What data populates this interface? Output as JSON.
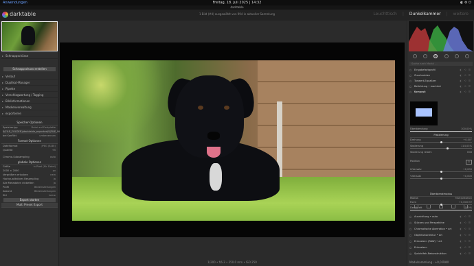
{
  "os": {
    "app_menu": "Anwendungen",
    "clock": "Freitag, 18. Juli 2025 | 14:32",
    "tray": "◐ ⚙ ⏻"
  },
  "window": {
    "title": "darktable"
  },
  "header": {
    "app_name": "darktable",
    "collection_info": "1 Bild (#4) ausgewählt von 994 in aktueller Sammlung",
    "views": [
      "Leuchttisch",
      "Dunkelkammer",
      "weitere"
    ],
    "active_view": "Dunkelkammer"
  },
  "left": {
    "snapshots_label": "Schnappschüsse",
    "create_snapshot": "Schnappschuss erstellen",
    "modules": [
      "Verlauf",
      "Duplikat-Manager",
      "Pipette",
      "Verschlagwortung / Tagging",
      "Bildinformationen",
      "Maskenverwaltung",
      "exportieren"
    ],
    "storage_title": "Speicher-Optionen",
    "storage_rows": [
      {
        "k": "Speichertyp",
        "v": "Datei auf Festplatte"
      },
      {
        "k": "$(FILE_FOLDER)/darktable_exported/$(FILE_NAME)",
        "v": "…"
      },
      {
        "k": "bei Konflikt",
        "v": "umbenennen"
      }
    ],
    "format_title": "Format-Optionen",
    "format_rows": [
      {
        "k": "Dateiformat",
        "v": "JPEG (8-Bit)"
      },
      {
        "k": "Qualität",
        "v": "95"
      },
      {
        "k": "Chroma-Subsampling",
        "v": "auto"
      }
    ],
    "global_title": "globale Optionen",
    "global_rows": [
      {
        "k": "Größe",
        "v": "in Pixel (für Datei)"
      },
      {
        "k": "2000 × 2000",
        "v": "px"
      },
      {
        "k": "Vergrößern erlauben",
        "v": "nein"
      },
      {
        "k": "Hochqualitatives Resampling",
        "v": "ja"
      },
      {
        "k": "Alle Metadaten einbetten",
        "v": "ja"
      },
      {
        "k": "Profil",
        "v": "Bildeinstellungen"
      },
      {
        "k": "Absicht",
        "v": "Bildeinstellungen"
      },
      {
        "k": "Stil",
        "v": "keine"
      }
    ],
    "export_button": "Export starten",
    "multi_export_button": "Multi Preset Export"
  },
  "center": {
    "statusline": "1/200 • f/6.3 • 250.0 mm • ISO 250"
  },
  "right": {
    "search_placeholder": "Suche nach Modul …",
    "modules_top": [
      "Eingabefarbprofil",
      "Zuschneiden",
      "Tonwert-Equalizer",
      "Belichtung • markiert",
      "Komposit"
    ],
    "preview_label": "Überblendung",
    "preview_value": "100,00%",
    "placement_title": "Platzierung",
    "placement_sliders": [
      {
        "label": "Drehung",
        "value": "+0,00°",
        "pct": 50
      },
      {
        "label": "Skalierung",
        "value": "114,03%",
        "pct": 60
      },
      {
        "label": "Skalierung relativ",
        "value": "Bild",
        "pct": 0
      },
      {
        "label": "Position",
        "value": "⊡",
        "pct": 0
      },
      {
        "label": "X-Versatz",
        "value": "+0,000",
        "pct": 50
      },
      {
        "label": "Y-Versatz",
        "value": "+0,000",
        "pct": 50
      }
    ],
    "blend_title": "Überblendmodus",
    "blend_rows": [
      {
        "label": "Modus",
        "value": "Multiplikation"
      },
      {
        "label": "Form",
        "value": "+0,000 EV"
      },
      {
        "label": "Deckkraft",
        "value": "100%"
      }
    ],
    "modules_bottom": [
      "Ausrichtung • auto",
      "Stürzen und Perspektive",
      "Chromatische Aberration • art",
      "Objektivkorrektur • art",
      "Entrastern (RAW) • art",
      "Entrastern",
      "Sprichtfeh-Rekonstruktion"
    ],
    "bottom_status": "Modulsammlung · +0,0 RAW"
  }
}
